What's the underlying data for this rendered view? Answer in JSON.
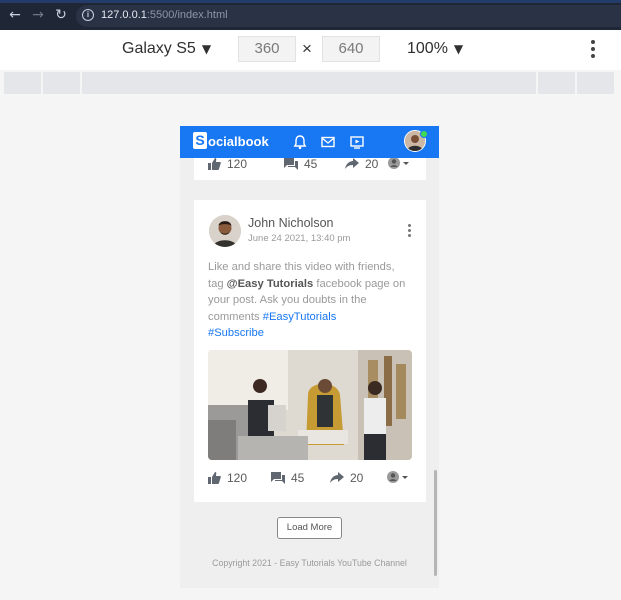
{
  "browser": {
    "url_host": "127.0.0.1",
    "url_rest": ":5500/index.html"
  },
  "devtools": {
    "device": "Galaxy S5",
    "width": "360",
    "height": "640",
    "times": "×",
    "zoom": "100%"
  },
  "app": {
    "logo_first": "S",
    "logo_rest": "ocialbook",
    "brand_color": "#1877f2"
  },
  "prev_post": {
    "likes": "120",
    "comments": "45",
    "shares": "20"
  },
  "post": {
    "author": "John Nicholson",
    "date": "June 24 2021, 13:40 pm",
    "text_1": "Like and share this video with friends, tag ",
    "mention": "@Easy Tutorials",
    "text_2": " facebook page on your post. Ask you doubts in the comments ",
    "hashtag_1": "#EasyTutorials",
    "hashtag_2": "#Subscribe",
    "likes": "120",
    "comments": "45",
    "shares": "20"
  },
  "load_more": "Load More",
  "footer": "Copyright 2021 - Easy Tutorials YouTube Channel"
}
